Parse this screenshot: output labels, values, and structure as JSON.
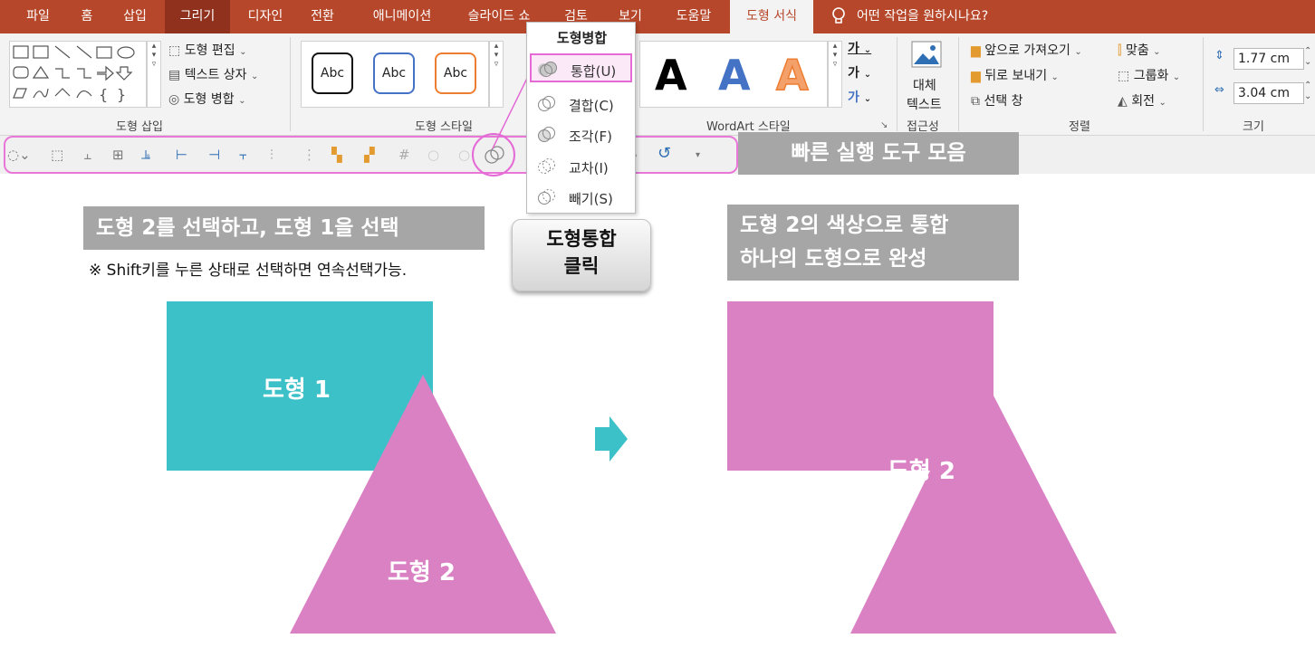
{
  "ribbon": {
    "tabs": [
      "파일",
      "홈",
      "삽입",
      "그리기",
      "디자인",
      "전환",
      "애니메이션",
      "슬라이드 쇼",
      "검토",
      "보기",
      "도움말",
      "도형 서식"
    ],
    "tell_me": "어떤 작업을 원하시나요?",
    "insert_shapes": {
      "edit_shape": "도형 편집",
      "text_box": "텍스트 상자",
      "merge_shapes": "도형 병합",
      "label": "도형 삽입"
    },
    "shape_styles": {
      "sample": "Abc",
      "label": "도형 스타일",
      "style_colors": [
        "#111111",
        "#4472c4",
        "#ed7d31"
      ]
    },
    "wordart": {
      "letter": "A",
      "label": "WordArt 스타일",
      "text_fill_glyph": "가",
      "letter_colors": [
        "#000000",
        "#4472c4",
        "#ed7d31"
      ]
    },
    "accessibility": {
      "alt_text_line1": "대체",
      "alt_text_line2": "텍스트",
      "label": "접근성"
    },
    "arrange": {
      "bring_forward": "앞으로 가져오기",
      "send_backward": "뒤로 보내기",
      "selection_pane": "선택 창",
      "align": "맞춤",
      "group": "그룹화",
      "rotate": "회전",
      "label": "정렬"
    },
    "size": {
      "height": "1.77 cm",
      "width": "3.04 cm",
      "label": "크기"
    }
  },
  "merge_menu": {
    "title": "도형병합",
    "items": [
      {
        "label": "통합(U)",
        "icon": "union-icon"
      },
      {
        "label": "결합(C)",
        "icon": "combine-icon"
      },
      {
        "label": "조각(F)",
        "icon": "fragment-icon"
      },
      {
        "label": "교차(I)",
        "icon": "intersect-icon"
      },
      {
        "label": "빼기(S)",
        "icon": "subtract-icon"
      }
    ]
  },
  "annotations": {
    "qat_label": "빠른 실행 도구 모음",
    "step_select": "도형  2를 선택하고, 도형 1을 선택",
    "note": "※ Shift키를 누른 상태로 선택하면 연속선택가능.",
    "click_line1": "도형통합",
    "click_line2": "클릭",
    "result_line1": "도형 2의 색상으로 통합",
    "result_line2": "하나의 도형으로 완성"
  },
  "slide": {
    "shape1_label": "도형 1",
    "shape2_label": "도형 2",
    "result_label": "도형 2",
    "colors": {
      "shape1": "#3dc1c8",
      "shape2": "#da81c4",
      "arrow": "#3dc1c8",
      "highlight": "#e877d8"
    }
  }
}
